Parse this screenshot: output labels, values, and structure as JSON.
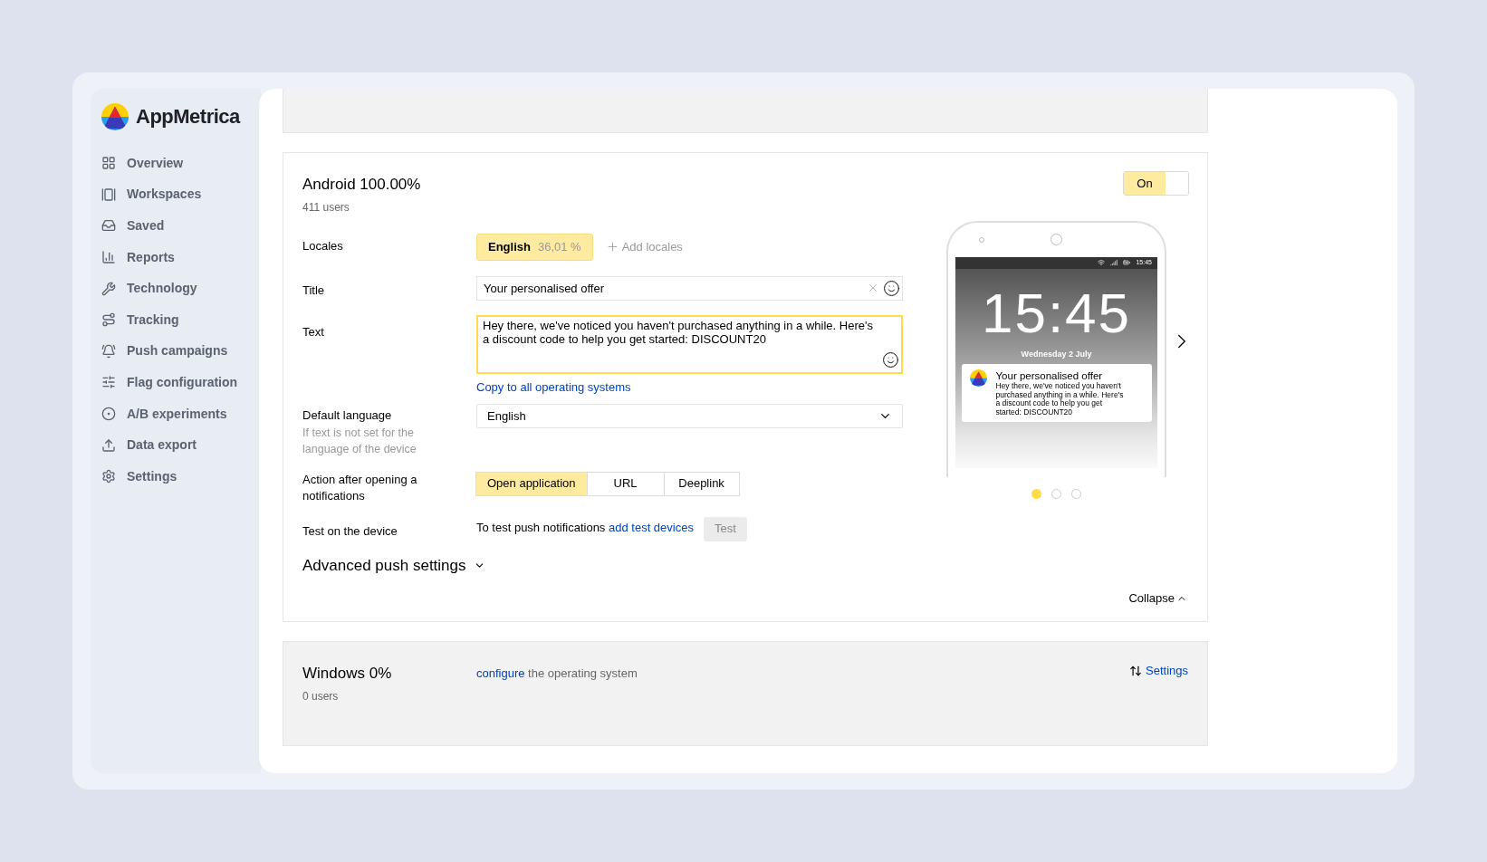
{
  "brand": "AppMetrica",
  "nav": [
    {
      "label": "Overview"
    },
    {
      "label": "Workspaces"
    },
    {
      "label": "Saved"
    },
    {
      "label": "Reports"
    },
    {
      "label": "Technology"
    },
    {
      "label": "Tracking"
    },
    {
      "label": "Push campaigns"
    },
    {
      "label": "Flag configuration"
    },
    {
      "label": "A/B experiments"
    },
    {
      "label": "Data export"
    },
    {
      "label": "Settings"
    }
  ],
  "android": {
    "title": "Android 100.00%",
    "users": "411 users",
    "toggle": {
      "label": "On",
      "on": true
    },
    "locales": {
      "label": "Locales",
      "items": [
        {
          "name": "English",
          "share": "36,01 %",
          "selected": true
        }
      ],
      "add": "Add locales"
    },
    "title_field": {
      "label": "Title",
      "value": "Your personalised offer"
    },
    "text_field": {
      "label": "Text",
      "value": "Hey there, we've noticed you haven't purchased anything in a while. Here's a discount code to help you get started: DISCOUNT20",
      "focused": true
    },
    "copy_link": "Copy to all operating systems",
    "default_language": {
      "label": "Default language",
      "hint": "If text is not set for the language of the device",
      "value": "English"
    },
    "action": {
      "label": "Action after opening a notifications",
      "options": [
        {
          "label": "Open application",
          "selected": true
        },
        {
          "label": "URL",
          "selected": false
        },
        {
          "label": "Deeplink",
          "selected": false
        }
      ]
    },
    "test": {
      "label": "Test on the device",
      "text": "To test push notifications",
      "link": "add test devices",
      "button": "Test",
      "disabled": true
    },
    "advanced": {
      "label": "Advanced push settings",
      "expanded": false
    },
    "collapse": "Collapse"
  },
  "preview": {
    "status_time": "15:45",
    "clock": "15:45",
    "date": "Wednesday 2 July",
    "notification": {
      "title": "Your personalised offer",
      "text": "Hey there, we've noticed you haven't purchased anything in a while. Here's a discount code to help you get started: DISCOUNT20"
    },
    "pages": [
      {
        "selected": true
      },
      {
        "selected": false
      },
      {
        "selected": false
      }
    ]
  },
  "windows": {
    "title": "Windows 0%",
    "users": "0 users",
    "link": "configure",
    "text": "the operating system",
    "settings": "Settings"
  }
}
